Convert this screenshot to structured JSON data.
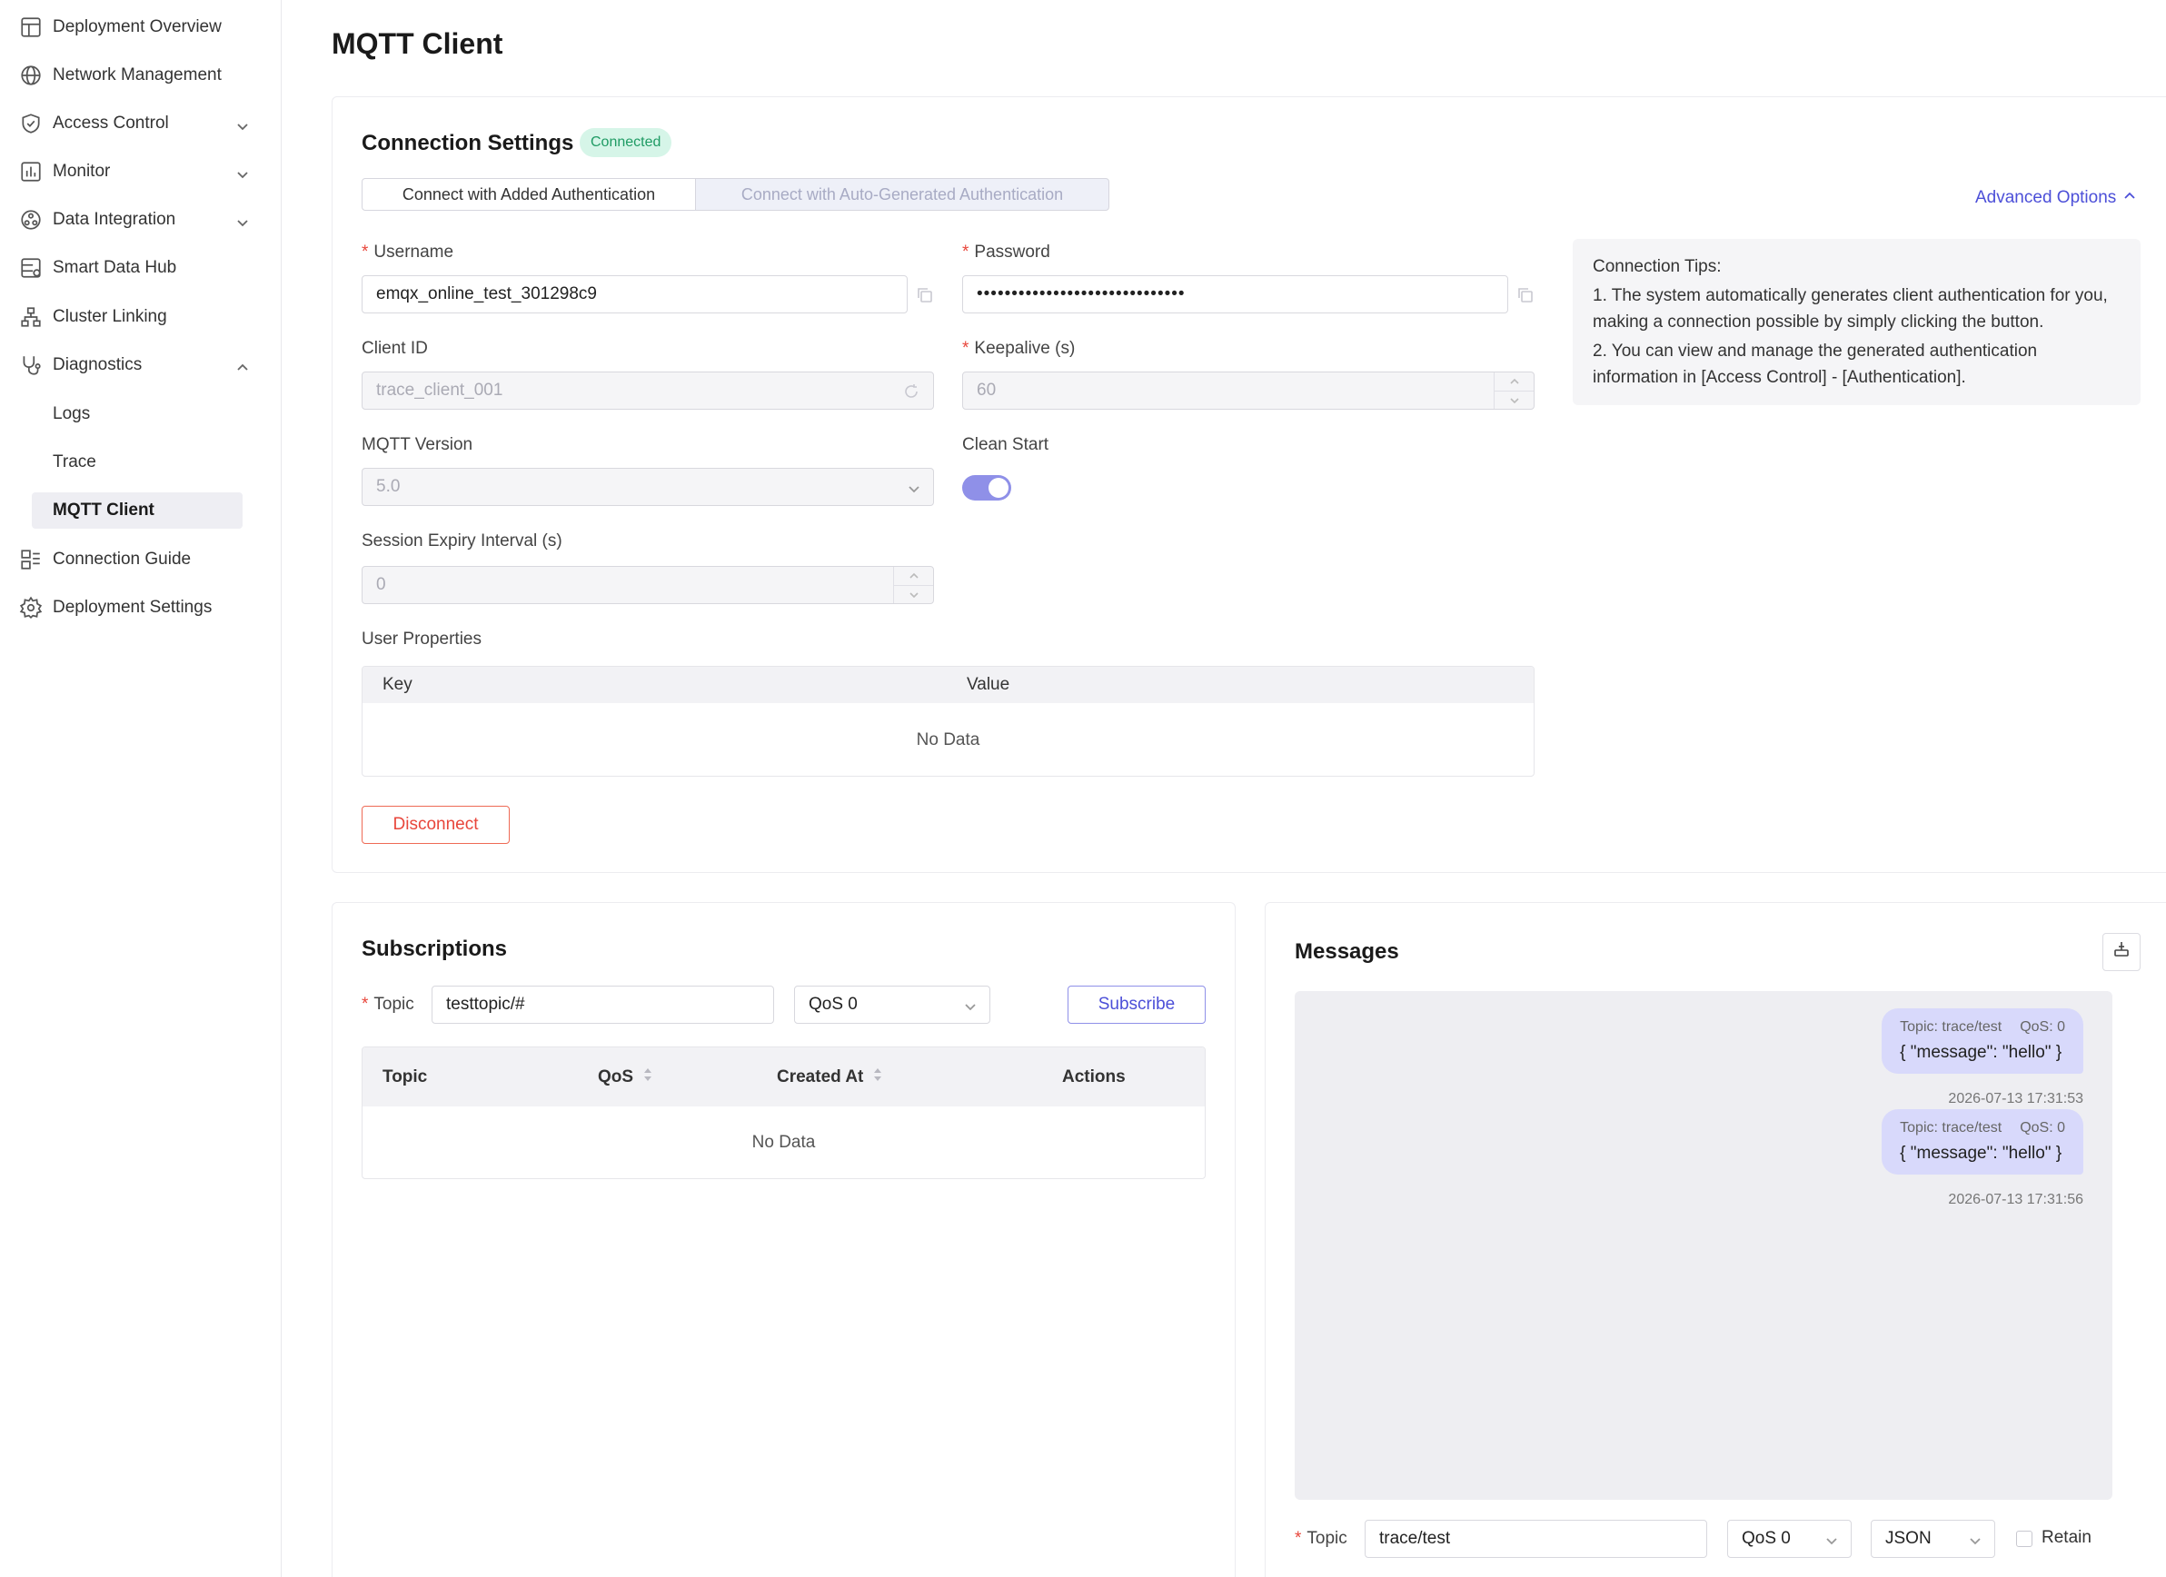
{
  "sidebar": {
    "items": [
      {
        "label": "Deployment Overview"
      },
      {
        "label": "Network Management"
      },
      {
        "label": "Access Control"
      },
      {
        "label": "Monitor"
      },
      {
        "label": "Data Integration"
      },
      {
        "label": "Smart Data Hub"
      },
      {
        "label": "Cluster Linking"
      },
      {
        "label": "Diagnostics"
      },
      {
        "label": "Connection Guide"
      },
      {
        "label": "Deployment Settings"
      }
    ],
    "diagnostics_children": [
      {
        "label": "Logs"
      },
      {
        "label": "Trace"
      },
      {
        "label": "MQTT Client",
        "active": true
      }
    ]
  },
  "page": {
    "title": "MQTT Client"
  },
  "connection": {
    "title": "Connection Settings",
    "status": "Connected",
    "auth_tabs": [
      "Connect with Added Authentication",
      "Connect with Auto-Generated Authentication"
    ],
    "advanced_label": "Advanced Options",
    "username_label": "Username",
    "username_value": "emqx_online_test_301298c9",
    "password_label": "Password",
    "password_value": "••••••••••••••••••••••••••••••",
    "client_id_label": "Client ID",
    "client_id_value": "trace_client_001",
    "keepalive_label": "Keepalive (s)",
    "keepalive_value": "60",
    "mqtt_version_label": "MQTT Version",
    "mqtt_version_value": "5.0",
    "clean_start_label": "Clean Start",
    "clean_start_on": true,
    "session_expiry_label": "Session Expiry Interval (s)",
    "session_expiry_value": "0",
    "user_props_label": "User Properties",
    "user_props_columns": [
      "Key",
      "Value"
    ],
    "user_props_empty": "No Data",
    "disconnect_label": "Disconnect",
    "tips": {
      "title": "Connection Tips:",
      "lines": [
        "1. The system automatically generates client authentication for you, making a connection possible by simply clicking the button.",
        "2. You can view and manage the generated authentication information in [Access Control] - [Authentication]."
      ]
    }
  },
  "subscriptions": {
    "title": "Subscriptions",
    "topic_label": "Topic",
    "topic_value": "testtopic/#",
    "qos_value": "QoS 0",
    "subscribe_label": "Subscribe",
    "columns": [
      "Topic",
      "QoS",
      "Created At",
      "Actions"
    ],
    "empty": "No Data"
  },
  "messages": {
    "title": "Messages",
    "items": [
      {
        "topic": "Topic: trace/test",
        "qos": "QoS: 0",
        "payload": "{ \"message\": \"hello\" }",
        "time": "2026-07-13 17:31:53"
      },
      {
        "topic": "Topic: trace/test",
        "qos": "QoS: 0",
        "payload": "{ \"message\": \"hello\" }",
        "time": "2026-07-13 17:31:56"
      }
    ],
    "publish_topic_label": "Topic",
    "publish_topic_value": "trace/test",
    "publish_qos": "QoS 0",
    "publish_format": "JSON",
    "retain_label": "Retain"
  },
  "colors": {
    "accent": "#4c4fd8",
    "success": "#1f9b64",
    "danger": "#e8463b"
  }
}
